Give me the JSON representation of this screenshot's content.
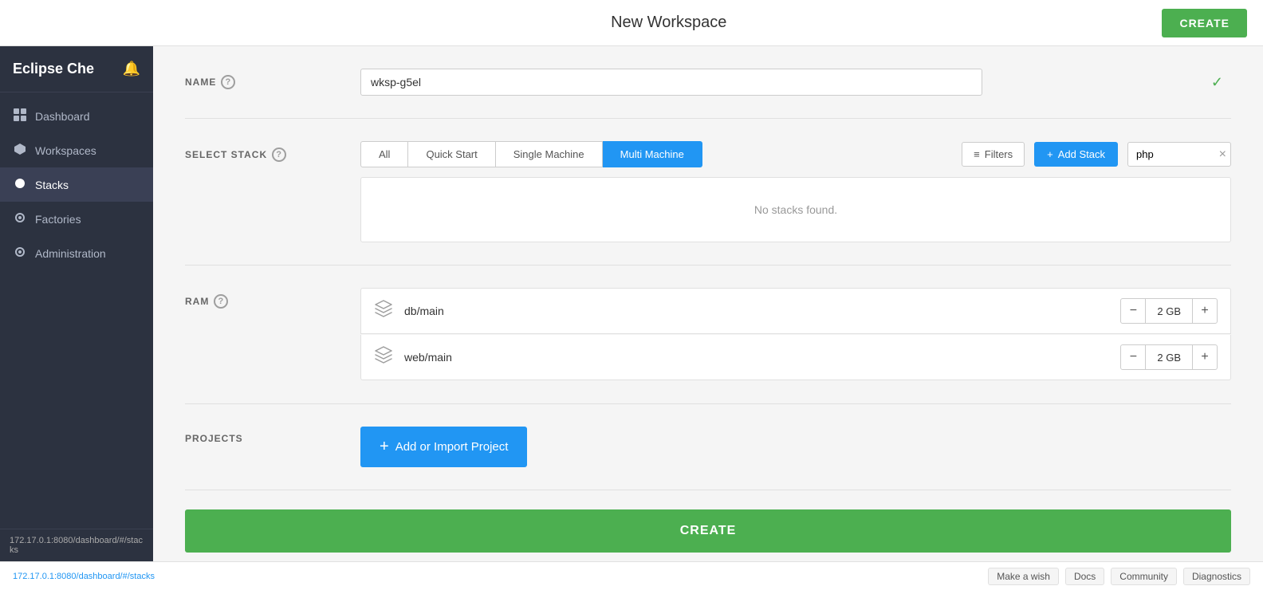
{
  "app": {
    "title": "Eclipse Che",
    "page_title": "New Workspace"
  },
  "topbar": {
    "create_label": "CREATE"
  },
  "sidebar": {
    "logo": "Eclipse Che",
    "items": [
      {
        "id": "dashboard",
        "label": "Dashboard",
        "icon": "⊞"
      },
      {
        "id": "workspaces",
        "label": "Workspaces",
        "icon": "⬡"
      },
      {
        "id": "stacks",
        "label": "Stacks",
        "icon": "○",
        "active": true
      },
      {
        "id": "factories",
        "label": "Factories",
        "icon": "⚙"
      },
      {
        "id": "administration",
        "label": "Administration",
        "icon": "⚙"
      }
    ],
    "url": "172.17.0.1:8080/dashboard/#/stacks"
  },
  "sections": {
    "name": {
      "label": "NAME",
      "value": "wksp-g5el"
    },
    "select_stack": {
      "label": "SELECT STACK",
      "tabs": [
        "All",
        "Quick Start",
        "Single Machine",
        "Multi Machine"
      ],
      "active_tab": "Multi Machine",
      "filters_label": "Filters",
      "add_stack_label": "Add Stack",
      "search_value": "php",
      "no_stacks_text": "No stacks found."
    },
    "ram": {
      "label": "RAM",
      "machines": [
        {
          "name": "db/main",
          "value": "2 GB"
        },
        {
          "name": "web/main",
          "value": "2 GB"
        }
      ]
    },
    "projects": {
      "label": "PROJECTS",
      "add_button_label": "Add or Import Project"
    }
  },
  "bottom_create": {
    "label": "CREATE"
  },
  "footer": {
    "url": "172.17.0.1:8080/dashboard/#/stacks",
    "links": [
      "Make a wish",
      "Docs",
      "Community",
      "Diagnostics"
    ]
  }
}
